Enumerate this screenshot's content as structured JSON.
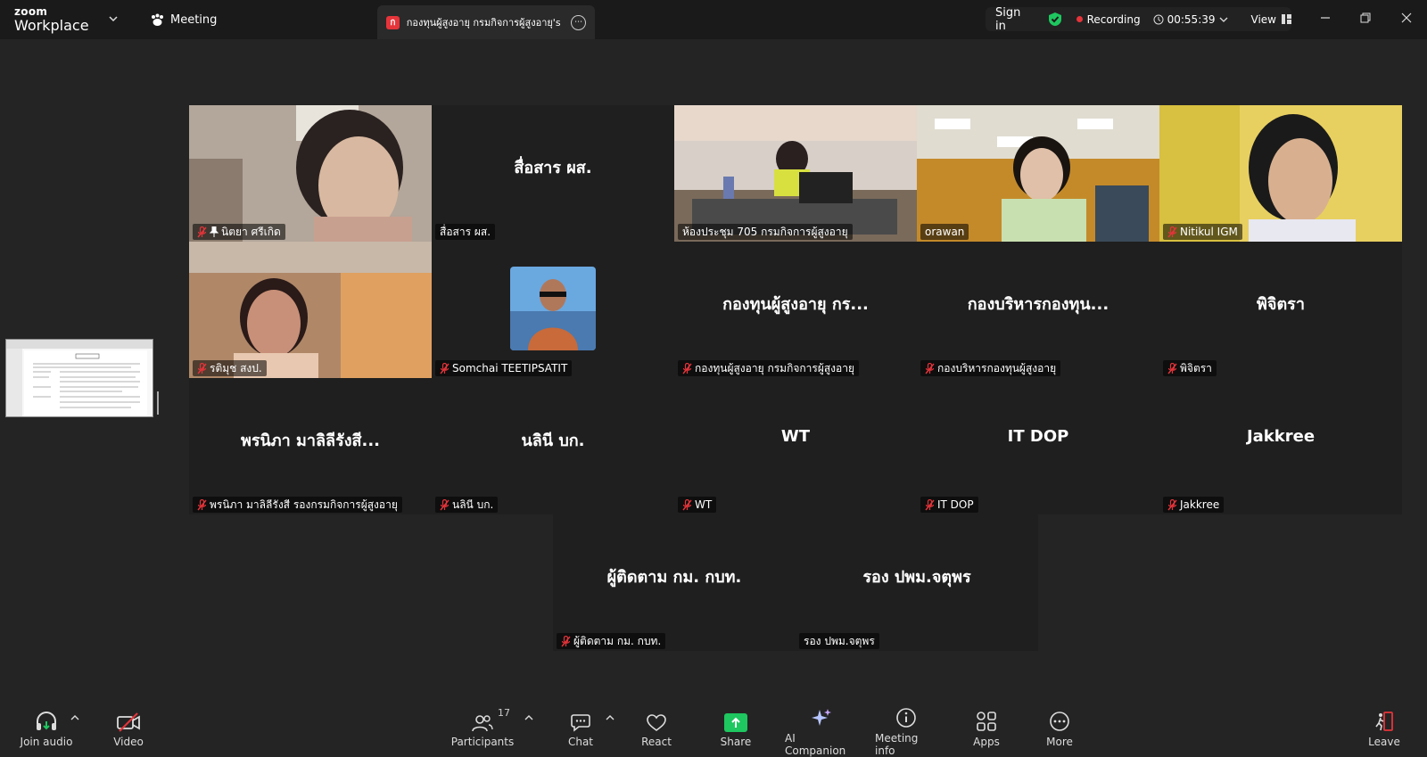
{
  "titlebar": {
    "brand_top": "zoom",
    "brand_bottom": "Workplace",
    "meeting_tab": "Meeting",
    "doc_tab_badge": "ก",
    "doc_tab_title": "กองทุนผู้สูงอายุ กรมกิจการผู้สูงอายุ's sc",
    "sign_in": "Sign in",
    "recording": "Recording",
    "timer": "00:55:39",
    "view": "View"
  },
  "colors": {
    "background": "#242424",
    "active_speaker": "#2cd6a0",
    "recording": "#e5343a",
    "share": "#1ec760"
  },
  "tiles": [
    {
      "name": "นิตยา ศรีเกิด",
      "center": "",
      "video": true,
      "pinned": true,
      "muted": true
    },
    {
      "name": "สื่อสาร ผส.",
      "center": "สื่อสาร ผส.",
      "video": false,
      "muted": false
    },
    {
      "name": "ห้องประชุม 705 กรมกิจการผู้สูงอายุ",
      "center": "",
      "video": true,
      "muted": false
    },
    {
      "name": "orawan",
      "center": "",
      "video": true,
      "muted": false,
      "active": true
    },
    {
      "name": "Nitikul IGM",
      "center": "",
      "video": true,
      "muted": true
    },
    {
      "name": "รติมุช สงป.",
      "center": "",
      "video": true,
      "muted": true
    },
    {
      "name": "Somchai TEETIPSATIT",
      "center": "",
      "video": false,
      "avatar": true,
      "muted": true
    },
    {
      "name": "กองทุนผู้สูงอายุ กรมกิจการผู้สูงอายุ",
      "center": "กองทุนผู้สูงอายุ กร...",
      "video": false,
      "muted": true
    },
    {
      "name": "กองบริหารกองทุนผู้สูงอายุ",
      "center": "กองบริหารกองทุน...",
      "video": false,
      "muted": true
    },
    {
      "name": "พิจิตรา",
      "center": "พิจิตรา",
      "video": false,
      "muted": true
    },
    {
      "name": "พรนิภา มาลิลีรังสี รองกรมกิจการผู้สูงอายุ",
      "center": "พรนิภา มาลิลีรังสี...",
      "video": false,
      "muted": true
    },
    {
      "name": "นลินี บก.",
      "center": "นลินี บก.",
      "video": false,
      "muted": true
    },
    {
      "name": "WT",
      "center": "WT",
      "video": false,
      "muted": true
    },
    {
      "name": "IT DOP",
      "center": "IT DOP",
      "video": false,
      "muted": true
    },
    {
      "name": "Jakkree",
      "center": "Jakkree",
      "video": false,
      "muted": true
    },
    {
      "name": "ผู้ติดตาม กม. กบท.",
      "center": "ผู้ติดตาม กม. กบท.",
      "video": false,
      "muted": true
    },
    {
      "name": "รอง ปพม.จตุพร",
      "center": "รอง ปพม.จตุพร",
      "video": false,
      "muted": false
    }
  ],
  "toolbar": {
    "join_audio": "Join audio",
    "video": "Video",
    "participants": "Participants",
    "participants_count": "17",
    "chat": "Chat",
    "react": "React",
    "share": "Share",
    "ai_companion": "AI Companion",
    "meeting_info": "Meeting info",
    "apps": "Apps",
    "more": "More",
    "leave": "Leave"
  }
}
